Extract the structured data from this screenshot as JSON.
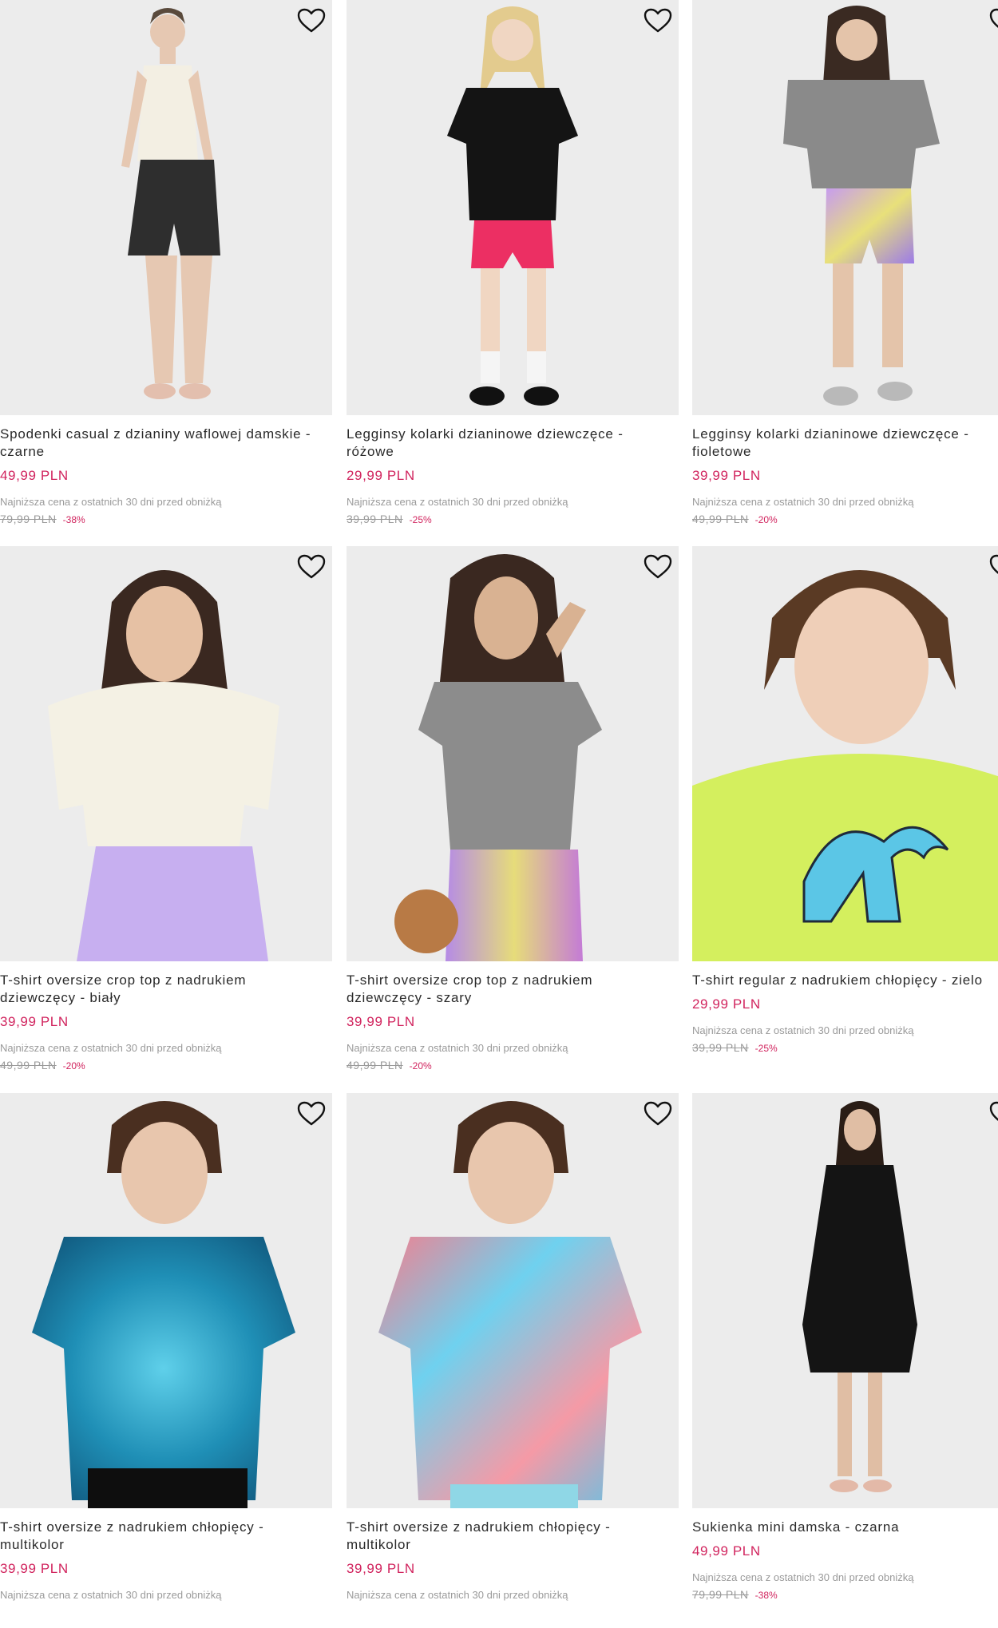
{
  "products": [
    {
      "title": "Spodenki casual z dzianiny waflowej damskie -\nczarne",
      "price": "49,99 PLN",
      "lowest_note": "Najniższa cena z ostatnich 30 dni przed obniżką",
      "old_price": "79,99 PLN",
      "discount": "-38%"
    },
    {
      "title": "Legginsy kolarki dzianinowe dziewczęce -\nróżowe",
      "price": "29,99 PLN",
      "lowest_note": "Najniższa cena z ostatnich 30 dni przed obniżką",
      "old_price": "39,99 PLN",
      "discount": "-25%"
    },
    {
      "title": "Legginsy kolarki dzianinowe dziewczęce -\nfioletowe",
      "price": "39,99 PLN",
      "lowest_note": "Najniższa cena z ostatnich 30 dni przed obniżką",
      "old_price": "49,99 PLN",
      "discount": "-20%"
    },
    {
      "title": "T-shirt oversize crop top z nadrukiem\ndziewczęcy - biały",
      "price": "39,99 PLN",
      "lowest_note": "Najniższa cena z ostatnich 30 dni przed obniżką",
      "old_price": "49,99 PLN",
      "discount": "-20%"
    },
    {
      "title": "T-shirt oversize crop top z nadrukiem\ndziewczęcy - szary",
      "price": "39,99 PLN",
      "lowest_note": "Najniższa cena z ostatnich 30 dni przed obniżką",
      "old_price": "49,99 PLN",
      "discount": "-20%"
    },
    {
      "title": "T-shirt regular z nadrukiem chłopięcy - zielo",
      "price": "29,99 PLN",
      "lowest_note": "Najniższa cena z ostatnich 30 dni przed obniżką",
      "old_price": "39,99 PLN",
      "discount": "-25%"
    },
    {
      "title": "T-shirt oversize z nadrukiem chłopięcy -\nmultikolor",
      "price": "39,99 PLN",
      "lowest_note": "Najniższa cena z ostatnich 30 dni przed obniżką",
      "old_price": "",
      "discount": ""
    },
    {
      "title": "T-shirt oversize z nadrukiem chłopięcy -\nmultikolor",
      "price": "39,99 PLN",
      "lowest_note": "Najniższa cena z ostatnich 30 dni przed obniżką",
      "old_price": "",
      "discount": ""
    },
    {
      "title": "Sukienka mini damska - czarna",
      "price": "49,99 PLN",
      "lowest_note": "Najniższa cena z ostatnich 30 dni przed obniżką",
      "old_price": "79,99 PLN",
      "discount": "-38%"
    }
  ],
  "colors": {
    "price": "#d1245e",
    "muted": "#9a9a9a",
    "image_bg": "#eeeeee"
  },
  "icons": {
    "wishlist": "heart-outline-icon"
  }
}
